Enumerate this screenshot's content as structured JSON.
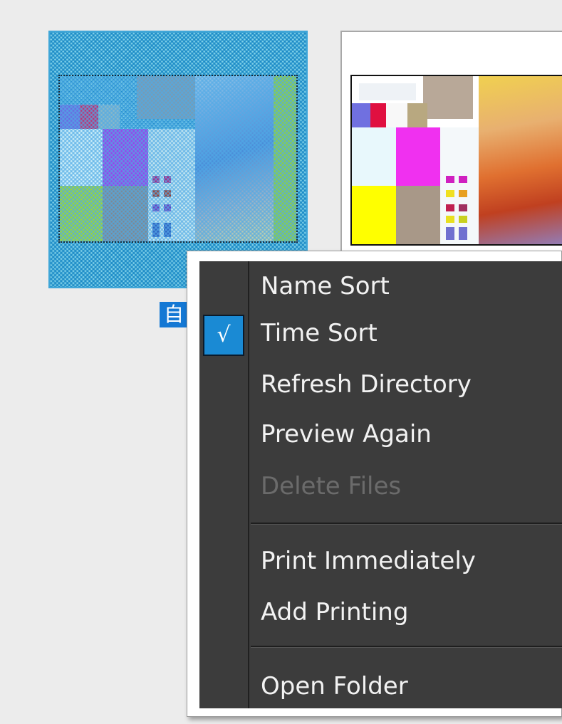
{
  "files": [
    {
      "label": "自",
      "selected": true
    },
    {
      "label": "",
      "selected": false
    }
  ],
  "colors": {
    "background": "#ececec",
    "selection_blue": "#1478d4",
    "menu_bg": "#3c3c3c",
    "menu_text": "#f2f2f2",
    "menu_disabled_text": "#6b6b6b",
    "check_bg": "#1a8ad4"
  },
  "context_menu": {
    "items": [
      {
        "label": "Name Sort",
        "checked": false,
        "disabled": false
      },
      {
        "label": "Time Sort",
        "checked": true,
        "check_mark": "√",
        "disabled": false
      },
      {
        "label": "Refresh Directory",
        "checked": false,
        "disabled": false
      },
      {
        "label": "Preview Again",
        "checked": false,
        "disabled": false
      },
      {
        "label": "Delete Files",
        "checked": false,
        "disabled": true
      },
      {
        "label": "Print Immediately",
        "checked": false,
        "disabled": false
      },
      {
        "label": "Add Printing",
        "checked": false,
        "disabled": false
      },
      {
        "label": "Open Folder",
        "checked": false,
        "disabled": false
      }
    ]
  }
}
